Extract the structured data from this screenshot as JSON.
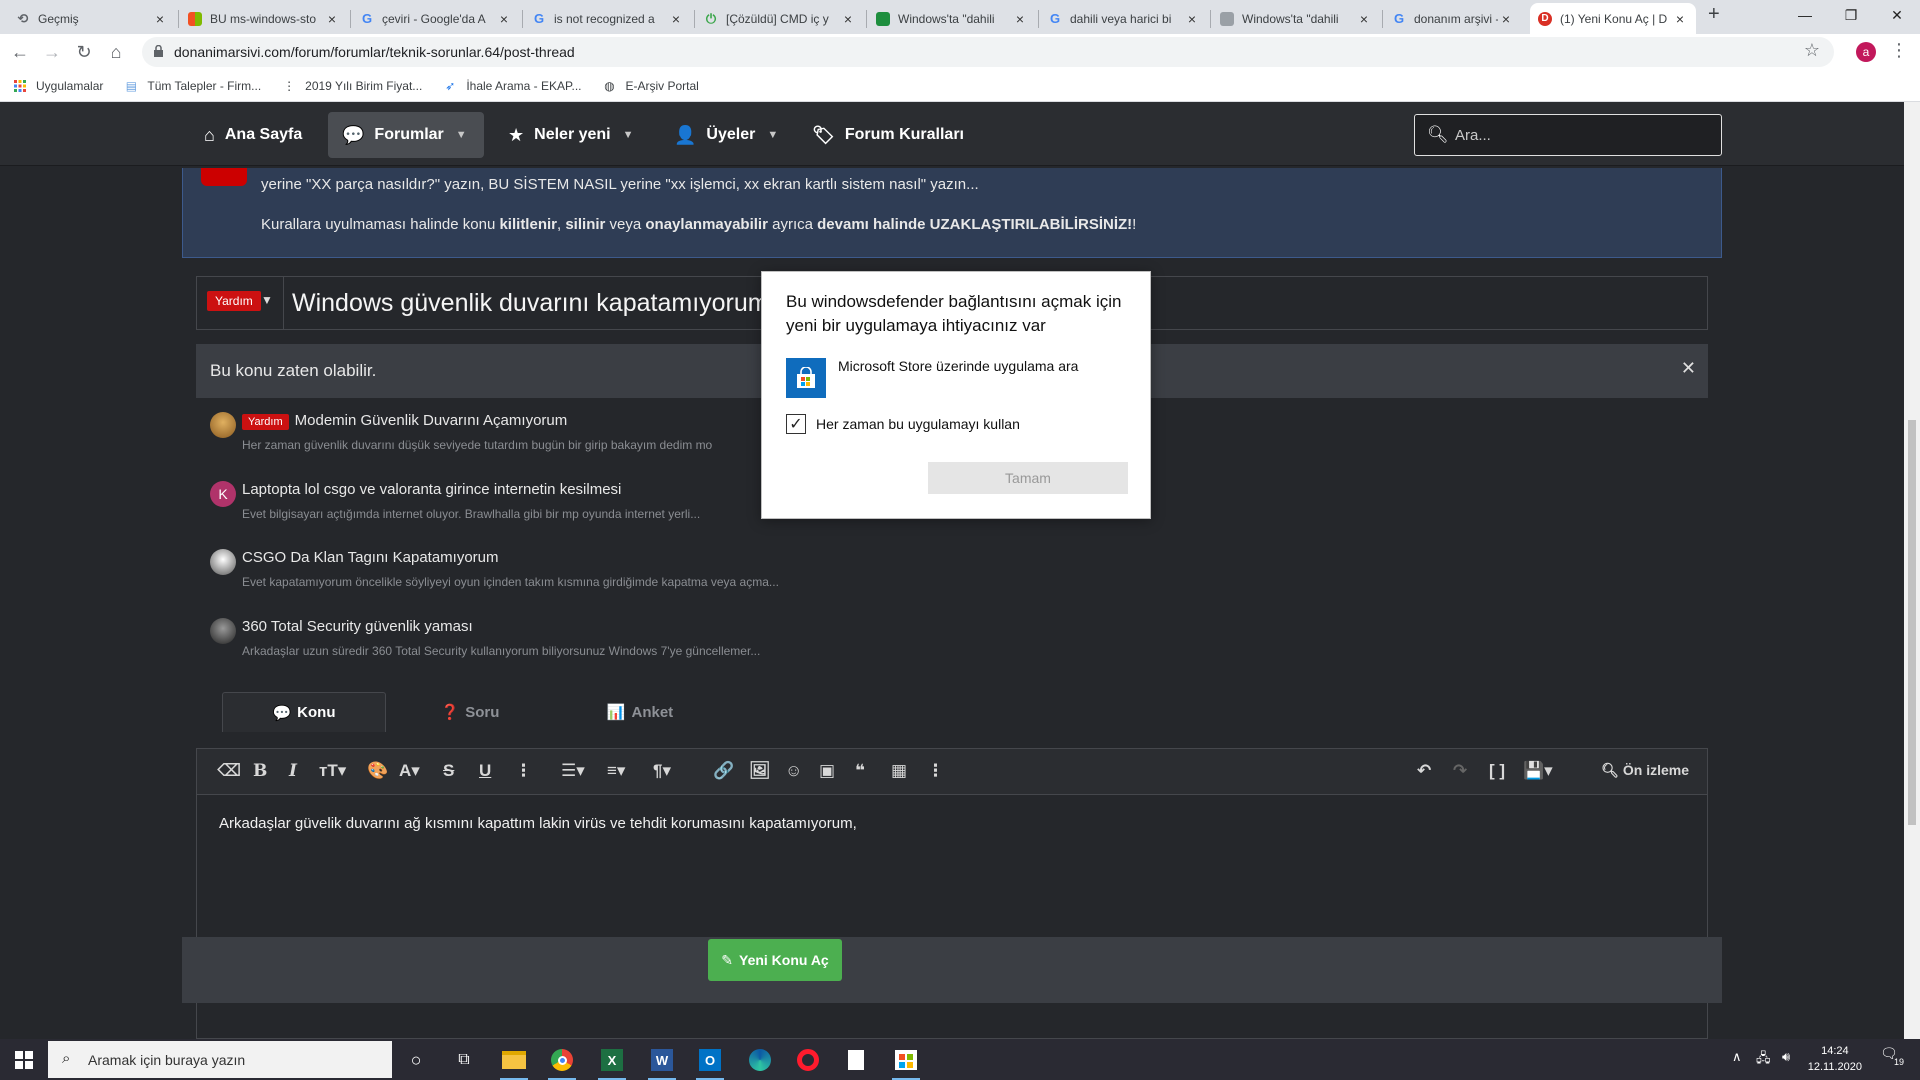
{
  "browser": {
    "tabs": [
      {
        "title": "Geçmiş",
        "favicon": "history-icon"
      },
      {
        "title": "BU ms-windows-sto",
        "favicon": "microsoft-icon"
      },
      {
        "title": "çeviri - Google'da A",
        "favicon": "google-icon"
      },
      {
        "title": "is not recognized a",
        "favicon": "google-icon"
      },
      {
        "title": "[Çözüldü] CMD iç y",
        "favicon": "power-icon"
      },
      {
        "title": "Windows'ta \"dahili",
        "favicon": "shop-icon"
      },
      {
        "title": "dahili veya harici bi",
        "favicon": "google-icon"
      },
      {
        "title": "Windows'ta \"dahili",
        "favicon": "page-icon"
      },
      {
        "title": "donanım arşivi - Go",
        "favicon": "google-icon"
      },
      {
        "title": "(1) Yeni Konu Aç | D",
        "favicon": "donanimarsivi-icon"
      }
    ],
    "active_tab": 9,
    "url": "donanimarsivi.com/forum/forumlar/teknik-sorunlar.64/post-thread",
    "profile_initial": "a",
    "bookmarks": [
      {
        "label": "Uygulamalar",
        "icon": "apps-icon"
      },
      {
        "label": "Tüm Talepler - Firm...",
        "icon": "page-icon"
      },
      {
        "label": "2019 Yılı Birim Fiyat...",
        "icon": "dots-icon"
      },
      {
        "label": "İhale Arama - EKAP...",
        "icon": "bird-icon"
      },
      {
        "label": "E-Arşiv Portal",
        "icon": "globe-icon"
      }
    ]
  },
  "forum": {
    "nav": {
      "home": "Ana Sayfa",
      "forums": "Forumlar",
      "whats_new": "Neler yeni",
      "members": "Üyeler",
      "rules": "Forum Kuralları",
      "search_placeholder": "Ara..."
    },
    "notice": {
      "line1": "yerine \"XX parça nasıldır?\" yazın, BU SİSTEM NASIL yerine \"xx işlemci, xx ekran kartlı sistem nasıl\" yazın...",
      "line2_a": "Kurallara uyulmaması halinde konu ",
      "line2_b": "kilitlenir",
      "line2_c": ", ",
      "line2_d": "silinir",
      "line2_e": " veya ",
      "line2_f": "onaylanmayabilir",
      "line2_g": " ayrıca ",
      "line2_h": "devamı halinde UZAKLAŞTIRILABİLİRSİNİZ!",
      "line2_i": "!"
    },
    "thread_prefix": "Yardım",
    "thread_title": "Windows güvenlik duvarını kapatamıyorum !",
    "similar_header": "Bu konu zaten olabilir.",
    "similar_threads": [
      {
        "prefix": "Yardım",
        "title": "Modemin Güvenlik Duvarını Açamıyorum",
        "snippet": "Her zaman güvenlik duvarını düşük seviyede tutardım bugün bir girip bakayım dedim mo"
      },
      {
        "prefix": "",
        "avatar_letter": "K",
        "title": "Laptopta lol csgo ve valoranta girince internetin kesilmesi",
        "snippet": "Evet bilgisayarı açtığımda internet oluyor. Brawlhalla gibi bir mp oyunda internet yerli..."
      },
      {
        "prefix": "",
        "title": "CSGO Da Klan Tagını Kapatamıyorum",
        "snippet": "Evet kapatamıyorum öncelikle söyliyeyi oyun içinden takım kısmına girdiğimde kapatma veya açma..."
      },
      {
        "prefix": "",
        "title": "360 Total Security güvenlik yaması",
        "snippet": "Arkadaşlar uzun süredir 360 Total Security kullanıyorum biliyorsunuz Windows 7'ye güncellemer..."
      }
    ],
    "post_tabs": [
      "Konu",
      "Soru",
      "Anket"
    ],
    "preview_label": "Ön izleme",
    "editor_text": "Arkadaşlar güvelik duvarını ağ kısmını kapattım lakin virüs ve tehdit korumasını kapatamıyorum,",
    "submit_label": "Yeni Konu Aç"
  },
  "dialog": {
    "title": "Bu windowsdefender bağlantısını açmak için yeni bir uygulamaya ihtiyacınız var",
    "option": "Microsoft Store üzerinde uygulama ara",
    "checkbox_label": "Her zaman bu uygulamayı kullan",
    "checkbox_checked": true,
    "ok_label": "Tamam"
  },
  "taskbar": {
    "search_placeholder": "Aramak için buraya yazın",
    "time": "14:24",
    "date": "12.11.2020",
    "notification_count": "19"
  },
  "colors": {
    "accent_red": "#cc1111",
    "submit_green": "#4caf50",
    "notice_blue": "#2f3d55",
    "page_bg": "#25272b"
  }
}
